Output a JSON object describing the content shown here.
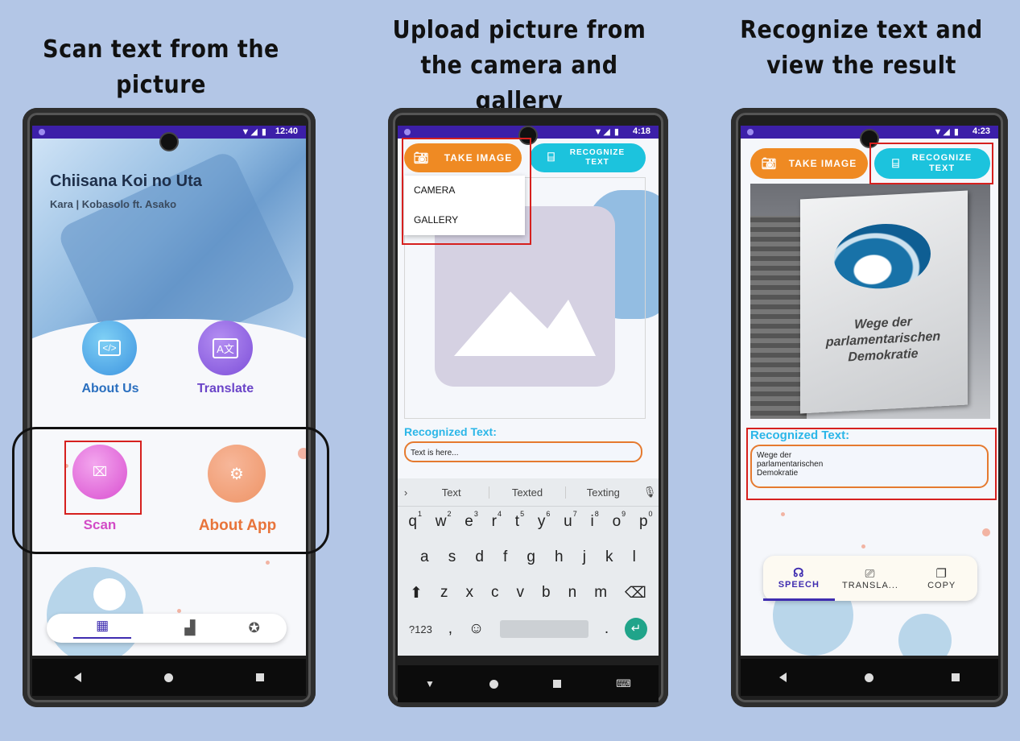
{
  "captions": {
    "left": "Scan text from the picture",
    "middle": "Upload picture from the camera and gallery",
    "right": "Recognize text and view the result"
  },
  "phone1": {
    "time": "12:40",
    "song_title": "Chiisana Koi no Uta",
    "song_artist": "Kara | Kobasolo ft. Asako",
    "about_us": "About Us",
    "translate": "Translate",
    "scan": "Scan",
    "about_app": "About App"
  },
  "phone2": {
    "time": "4:18",
    "take_image": "TAKE IMAGE",
    "recognize_text": "RECOGNIZE TEXT",
    "menu": [
      "CAMERA",
      "GALLERY"
    ],
    "recognized_label": "Recognized Text:",
    "text_placeholder": "Text is here...",
    "suggestions": [
      "Text",
      "Texted",
      "Texting"
    ],
    "keys_row1": [
      "q",
      "w",
      "e",
      "r",
      "t",
      "y",
      "u",
      "i",
      "o",
      "p"
    ],
    "keys_row1_nums": [
      "1",
      "2",
      "3",
      "4",
      "5",
      "6",
      "7",
      "8",
      "9",
      "0"
    ],
    "keys_row2": [
      "a",
      "s",
      "d",
      "f",
      "g",
      "h",
      "j",
      "k",
      "l"
    ],
    "keys_row3": [
      "z",
      "x",
      "c",
      "v",
      "b",
      "n",
      "m"
    ],
    "key_123": "?123",
    "key_comma": ",",
    "key_period": "."
  },
  "phone3": {
    "time": "4:23",
    "take_image": "TAKE IMAGE",
    "recognize_text": "RECOGNIZE TEXT",
    "sign_text": "Wege der parlamentarischen Demokratie",
    "recognized_label": "Recognized Text:",
    "result_lines": [
      "Wege der",
      "parlamentarischen",
      "Demokratie"
    ],
    "tabs": [
      "SPEECH",
      "TRANSLA...",
      "COPY"
    ]
  },
  "colors": {
    "background": "#b3c6e6",
    "status_bar": "#3c1fa8",
    "orange": "#ef8a23",
    "cyan": "#1cc3dd",
    "highlight": "#d6201e"
  }
}
